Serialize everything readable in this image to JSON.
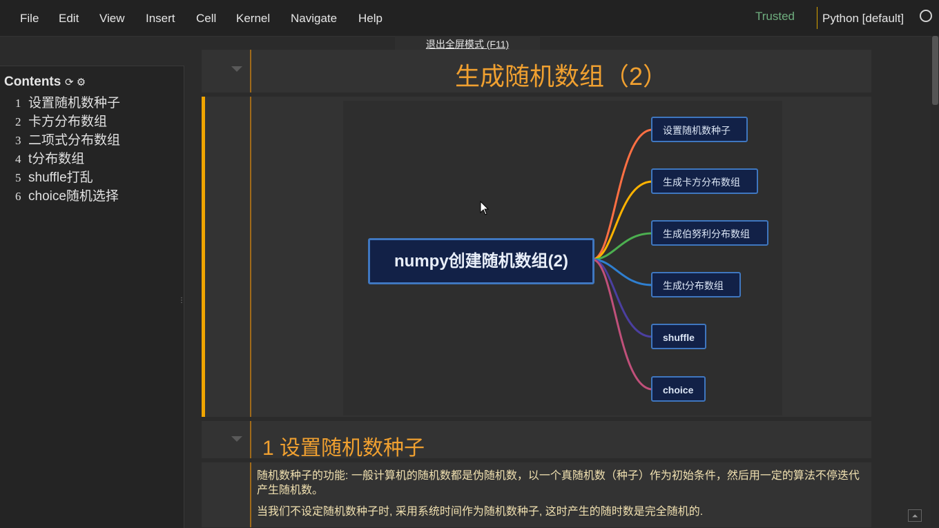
{
  "menu": {
    "items": [
      "File",
      "Edit",
      "View",
      "Insert",
      "Cell",
      "Kernel",
      "Navigate",
      "Help"
    ],
    "trusted": "Trusted",
    "kernel": "Python [default]"
  },
  "fullscreen_tip": "退出全屏模式 (F11)",
  "toc": {
    "title": "Contents",
    "items": [
      {
        "num": "1",
        "label": "设置随机数种子"
      },
      {
        "num": "2",
        "label": "卡方分布数组"
      },
      {
        "num": "3",
        "label": "二项式分布数组"
      },
      {
        "num": "4",
        "label": "t分布数组"
      },
      {
        "num": "5",
        "label": "shuffle打乱"
      },
      {
        "num": "6",
        "label": "choice随机选择"
      }
    ]
  },
  "notebook": {
    "title": "生成随机数组（2）",
    "mindmap": {
      "root": "numpy创建随机数组(2)",
      "children": [
        "设置随机数种子",
        "生成卡方分布数组",
        "生成伯努利分布数组",
        "生成t分布数组",
        "shuffle",
        "choice"
      ],
      "branch_colors": [
        "#ff7043",
        "#ffb300",
        "#4caf50",
        "#2f7fd0",
        "#4b3fa0",
        "#c0507a"
      ]
    },
    "section1_heading": "1  设置随机数种子",
    "para1": "随机数种子的功能: 一般计算机的随机数都是伪随机数，以一个真随机数（种子）作为初始条件，然后用一定的算法不停迭代产生随机数。",
    "para2": "当我们不设定随机数种子时, 采用系统时间作为随机数种子, 这时产生的随时数是完全随机的."
  }
}
